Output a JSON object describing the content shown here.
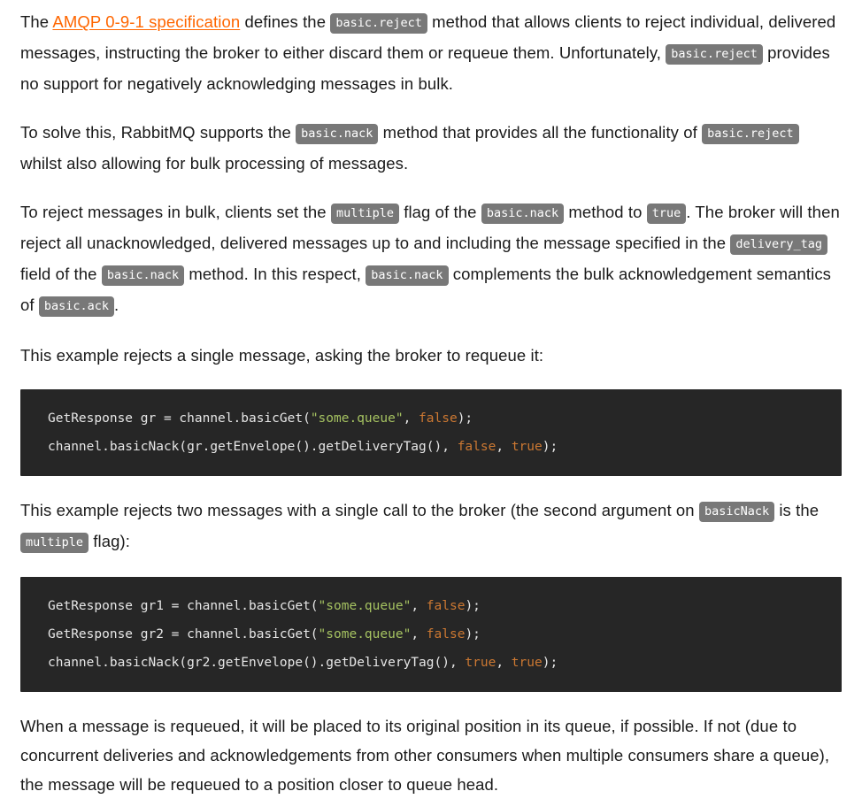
{
  "document": {
    "paragraphs": [
      {
        "id": "p1",
        "parts": [
          {
            "type": "text",
            "value": "The "
          },
          {
            "type": "link",
            "value": "AMQP 0-9-1 specification"
          },
          {
            "type": "text",
            "value": " defines the "
          },
          {
            "type": "code",
            "value": "basic.reject"
          },
          {
            "type": "text",
            "value": " method that allows clients to reject individual, delivered messages, instructing the broker to either discard them or requeue them. Unfortunately, "
          },
          {
            "type": "code",
            "value": "basic.reject"
          },
          {
            "type": "text",
            "value": " provides no support for negatively acknowledging messages in bulk."
          }
        ]
      },
      {
        "id": "p2",
        "parts": [
          {
            "type": "text",
            "value": "To solve this, RabbitMQ supports the "
          },
          {
            "type": "code",
            "value": "basic.nack"
          },
          {
            "type": "text",
            "value": " method that provides all the functionality of "
          },
          {
            "type": "code",
            "value": "basic.reject"
          },
          {
            "type": "text",
            "value": " whilst also allowing for bulk processing of messages."
          }
        ]
      },
      {
        "id": "p3",
        "parts": [
          {
            "type": "text",
            "value": "To reject messages in bulk, clients set the "
          },
          {
            "type": "code",
            "value": "multiple"
          },
          {
            "type": "text",
            "value": " flag of the "
          },
          {
            "type": "code",
            "value": "basic.nack"
          },
          {
            "type": "text",
            "value": " method to "
          },
          {
            "type": "code",
            "value": "true"
          },
          {
            "type": "text",
            "value": ". The broker will then reject all unacknowledged, delivered messages up to and including the message specified in the "
          },
          {
            "type": "code",
            "value": "delivery_tag"
          },
          {
            "type": "text",
            "value": " field of the "
          },
          {
            "type": "code",
            "value": "basic.nack"
          },
          {
            "type": "text",
            "value": " method. In this respect, "
          },
          {
            "type": "code",
            "value": "basic.nack"
          },
          {
            "type": "text",
            "value": " complements the bulk acknowledgement semantics of "
          },
          {
            "type": "code",
            "value": "basic.ack"
          },
          {
            "type": "text",
            "value": "."
          }
        ]
      },
      {
        "id": "p4",
        "parts": [
          {
            "type": "text",
            "value": "This example rejects a single message, asking the broker to requeue it:"
          }
        ]
      },
      {
        "id": "p5",
        "parts": [
          {
            "type": "text",
            "value": "This example rejects two messages with a single call to the broker (the second argument on "
          },
          {
            "type": "code",
            "value": "basicNack"
          },
          {
            "type": "text",
            "value": " is the "
          },
          {
            "type": "code",
            "value": "multiple"
          },
          {
            "type": "text",
            "value": " flag):"
          }
        ]
      },
      {
        "id": "p6",
        "parts": [
          {
            "type": "text",
            "value": "When a message is requeued, it will be placed to its original position in its queue, if possible. If not (due to concurrent deliveries and acknowledgements from other consumers when multiple consumers share a queue), the message will be requeued to a position closer to queue head."
          }
        ]
      }
    ],
    "code_blocks": [
      {
        "id": "cb1",
        "language": "java",
        "lines": [
          [
            {
              "cls": "tok-plain",
              "t": "GetResponse gr = channel.basicGet("
            },
            {
              "cls": "tok-string",
              "t": "\"some.queue\""
            },
            {
              "cls": "tok-plain",
              "t": ", "
            },
            {
              "cls": "tok-kw",
              "t": "false"
            },
            {
              "cls": "tok-plain",
              "t": ");"
            }
          ],
          [
            {
              "cls": "tok-plain",
              "t": "channel.basicNack(gr.getEnvelope().getDeliveryTag(), "
            },
            {
              "cls": "tok-kw",
              "t": "false"
            },
            {
              "cls": "tok-plain",
              "t": ", "
            },
            {
              "cls": "tok-kw",
              "t": "true"
            },
            {
              "cls": "tok-plain",
              "t": ");"
            }
          ]
        ]
      },
      {
        "id": "cb2",
        "language": "java",
        "lines": [
          [
            {
              "cls": "tok-plain",
              "t": "GetResponse gr1 = channel.basicGet("
            },
            {
              "cls": "tok-string",
              "t": "\"some.queue\""
            },
            {
              "cls": "tok-plain",
              "t": ", "
            },
            {
              "cls": "tok-kw",
              "t": "false"
            },
            {
              "cls": "tok-plain",
              "t": ");"
            }
          ],
          [
            {
              "cls": "tok-plain",
              "t": "GetResponse gr2 = channel.basicGet("
            },
            {
              "cls": "tok-string",
              "t": "\"some.queue\""
            },
            {
              "cls": "tok-plain",
              "t": ", "
            },
            {
              "cls": "tok-kw",
              "t": "false"
            },
            {
              "cls": "tok-plain",
              "t": ");"
            }
          ],
          [
            {
              "cls": "tok-plain",
              "t": "channel.basicNack(gr2.getEnvelope().getDeliveryTag(), "
            },
            {
              "cls": "tok-kw",
              "t": "true"
            },
            {
              "cls": "tok-plain",
              "t": ", "
            },
            {
              "cls": "tok-kw",
              "t": "true"
            },
            {
              "cls": "tok-plain",
              "t": ");"
            }
          ]
        ]
      }
    ],
    "order": [
      "p1",
      "p2",
      "p3",
      "p4",
      "cb1",
      "p5",
      "cb2",
      "p6"
    ],
    "colors": {
      "link": "#ff6600",
      "body_text": "#1a1a1a",
      "inline_code_bg": "#787878",
      "inline_code_text": "#ffffff",
      "code_block_bg": "#262626",
      "code_plain": "#e6e6e6",
      "code_string": "#a5c261",
      "code_keyword": "#cc7832",
      "page_bg": "#ffffff"
    }
  }
}
